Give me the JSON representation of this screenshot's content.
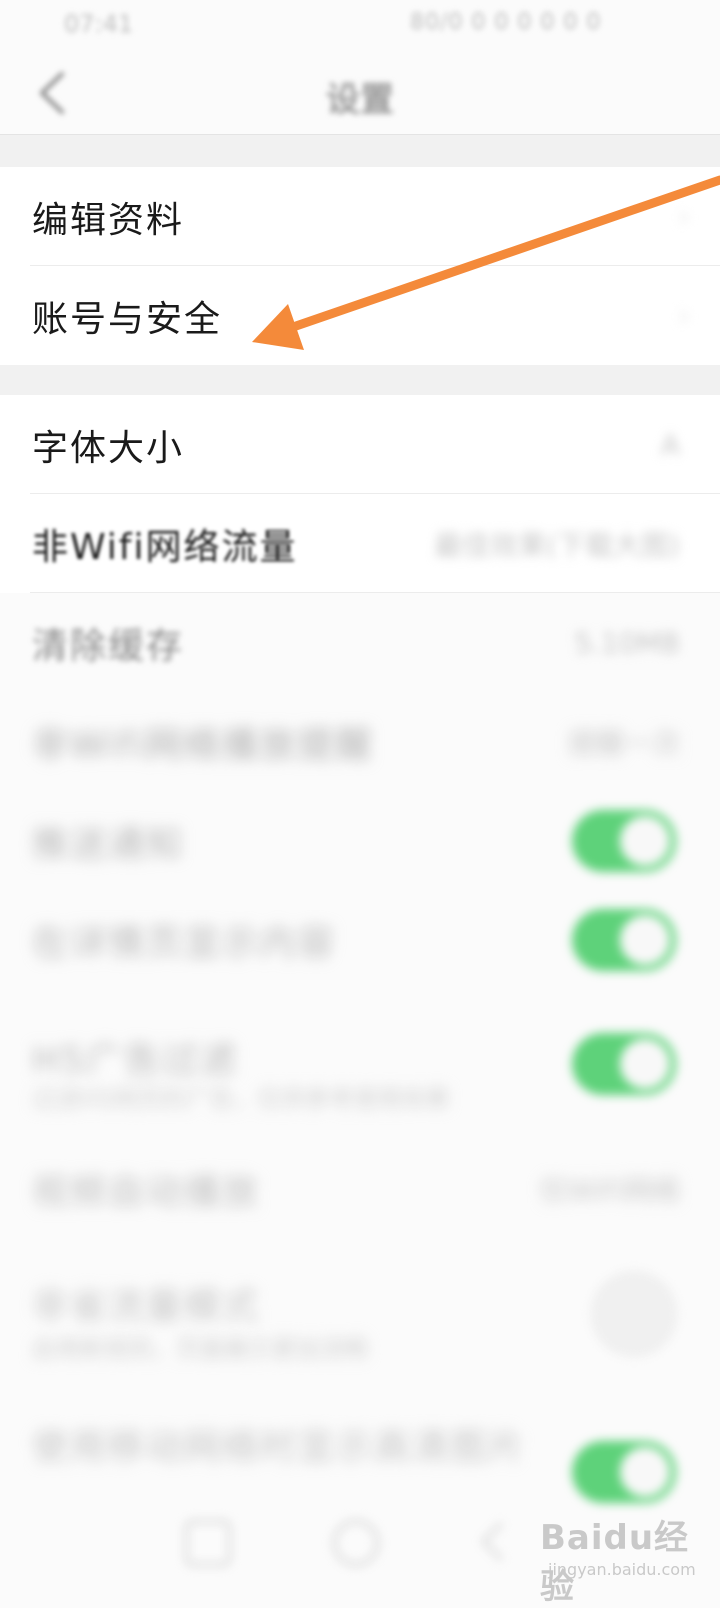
{
  "status_bar": {
    "time": "07:41",
    "right_info": "80/0 0 0 0 0 0 0"
  },
  "header": {
    "title": "设置"
  },
  "group1": [
    {
      "label": "编辑资料"
    },
    {
      "label": "账号与安全"
    }
  ],
  "group2": [
    {
      "label": "字体大小",
      "value": "A",
      "kind": "value"
    },
    {
      "label": "非Wifi网络流量",
      "value": "最佳效果(下载大图)",
      "kind": "value"
    },
    {
      "label": "清除缓存",
      "value": "5.10MB",
      "kind": "value"
    },
    {
      "label": "非Wifi网络播放提醒",
      "value": "提醒一次",
      "kind": "value"
    },
    {
      "label": "推送通知",
      "kind": "toggle",
      "on": true
    },
    {
      "label": "在详情页显示内容",
      "kind": "toggle",
      "on": true
    },
    {
      "label": "H5广告过滤",
      "subtitle": "过滤H5网页的广告，仅供参考使用效果",
      "kind": "toggle",
      "on": true
    },
    {
      "label": "视频自动播放",
      "value": "仅WiFi网络",
      "kind": "value"
    },
    {
      "label": "非省流量模式",
      "subtitle": "启用新规则，页面展示更加流畅",
      "kind": "toggle",
      "on": false
    },
    {
      "label": "使用移动网络时显示高清图片",
      "kind": "toggle",
      "on": true
    }
  ],
  "watermark": {
    "brand": "Baidu经验",
    "url": "jingyan.baidu.com"
  },
  "colors": {
    "accent_arrow": "#f48a3a",
    "toggle_on": "#5ed27a"
  }
}
